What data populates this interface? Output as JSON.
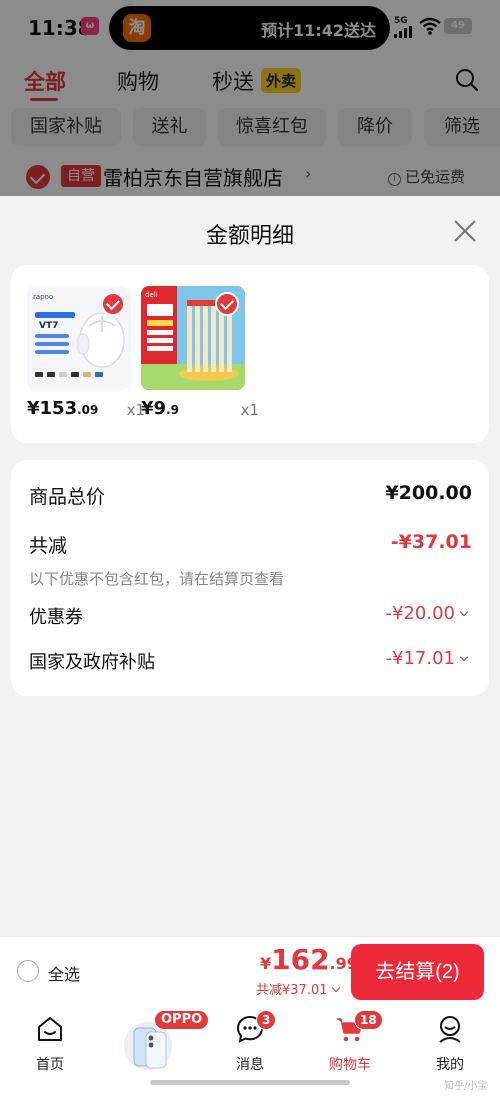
{
  "status_bar": {
    "time": "11:38",
    "live_activity_app_icon": "淘",
    "live_activity_text": "预计11:42送达",
    "network": "5G",
    "battery": "49"
  },
  "cart": {
    "tabs": [
      "全部",
      "购物",
      "秒送"
    ],
    "waimai_badge": "外卖",
    "filter_chips": [
      "国家补贴",
      "送礼",
      "惊喜红包",
      "降价",
      "筛选"
    ],
    "store": {
      "self_operated_badge": "自营",
      "name": "雷柏京东自营旗舰店",
      "chevron": "›",
      "shipping": "已免运费",
      "info_glyph": "i"
    }
  },
  "sheet": {
    "title": "金额明细",
    "products": [
      {
        "price_main": "¥153",
        "price_decimal": ".09",
        "qty": "x1",
        "image_icon": "wireless-mouse-product-image",
        "brand": "rapoo",
        "model": "VT7"
      },
      {
        "price_main": "¥9",
        "price_decimal": ".9",
        "qty": "x1",
        "image_icon": "pencil-set-product-image",
        "brand": "deli"
      }
    ],
    "summary": {
      "total_label": "商品总价",
      "total_value": "¥200.00",
      "reduce_label": "共减",
      "reduce_value": "-¥37.01",
      "note": "以下优惠不包含红包，请在结算页查看",
      "coupon_label": "优惠券",
      "coupon_value": "-¥20.00",
      "subsidy_label": "国家及政府补贴",
      "subsidy_value": "-¥17.01"
    }
  },
  "checkout": {
    "select_all": "全选",
    "price_symbol": "¥",
    "price_main": "162",
    "price_decimal": ".99",
    "saved": "共减¥37.01",
    "button": "去结算(2)"
  },
  "tabbar": {
    "items": [
      {
        "label": "首页",
        "icon": "home-icon"
      },
      {
        "label": "",
        "icon": "phone-promo-icon",
        "badge": "OPPO"
      },
      {
        "label": "消息",
        "icon": "message-icon",
        "badge": "3"
      },
      {
        "label": "购物车",
        "icon": "cart-icon",
        "badge": "18"
      },
      {
        "label": "我的",
        "icon": "profile-icon"
      }
    ]
  },
  "watermark": "知乎/小宝",
  "colors": {
    "accent": "#e4393c",
    "checkout_button": "#ee2a3a",
    "background": "#f2f2f2"
  }
}
